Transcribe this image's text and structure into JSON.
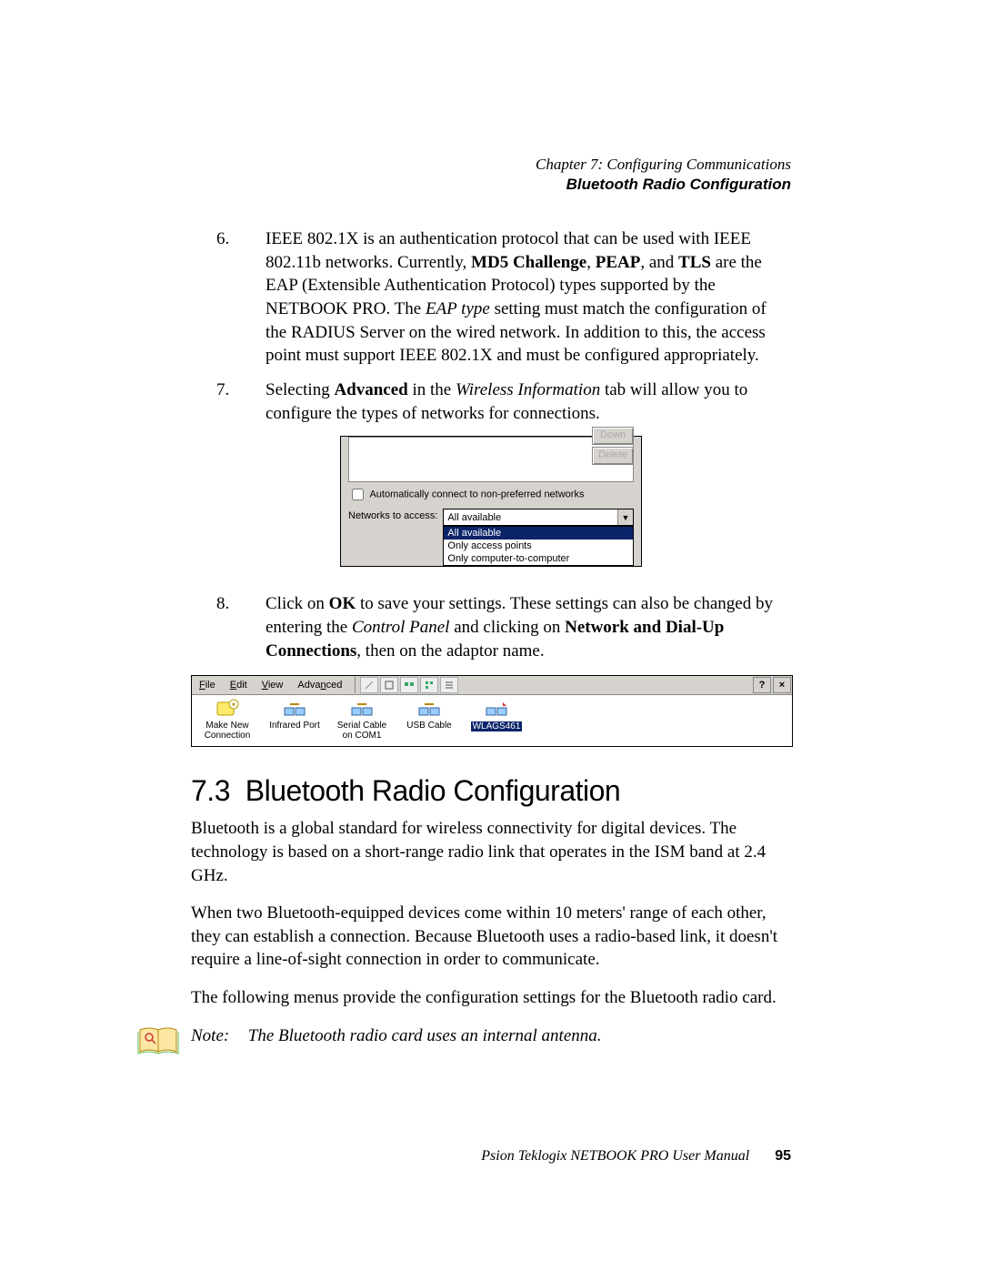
{
  "header": {
    "chapter": "Chapter 7:  Configuring Communications",
    "subtitle": "Bluetooth Radio Configuration"
  },
  "steps": {
    "s6": {
      "num": "6.",
      "text_pre": "IEEE 802.1X is an authentication protocol that can be used with IEEE 802.11b networks. Currently, ",
      "md5": "MD5 Challenge",
      "sep1": ", ",
      "peap": "PEAP",
      "sep2": ", and ",
      "tls": "TLS",
      "text_post1": " are the EAP (Extensible Authentication Protocol) types supported by the NETBOOK PRO. The ",
      "eaptype": "EAP type",
      "text_post2": " setting must match the configuration of the RADIUS Server on the wired network. In addition to this, the access point must support IEEE 802.1X and must be configured appropriately."
    },
    "s7": {
      "num": "7.",
      "t1": "Selecting ",
      "adv": "Advanced",
      "t2": " in the ",
      "wi": "Wireless Information",
      "t3": " tab will allow you to configure the types of networks for connections."
    },
    "s8": {
      "num": "8.",
      "t1": "Click on ",
      "ok": "OK",
      "t2": " to save your settings. These settings can also be changed by entering the ",
      "cp": "Control Panel",
      "t3": " and clicking on ",
      "ndc": "Network and Dial-Up Connections",
      "t4": ", then on the adaptor name."
    }
  },
  "shot1": {
    "down_btn": "Down",
    "delete_btn": "Delete",
    "checkbox_label": "Automatically connect to non-preferred networks",
    "networks_label": "Networks to access:",
    "selected": "All available",
    "options": [
      "All available",
      "Only access points",
      "Only computer-to-computer"
    ]
  },
  "shot2": {
    "menus": {
      "file": "File",
      "edit": "Edit",
      "view": "View",
      "advanced": "Advanced"
    },
    "help_btn": "?",
    "close_btn": "×",
    "icons": [
      {
        "label_line1": "Make New",
        "label_line2": "Connection"
      },
      {
        "label_line1": "Infrared Port",
        "label_line2": ""
      },
      {
        "label_line1": "Serial Cable",
        "label_line2": "on COM1"
      },
      {
        "label_line1": "USB Cable",
        "label_line2": ""
      },
      {
        "label_line1": "WLAGS461",
        "label_line2": ""
      }
    ]
  },
  "section": {
    "number": "7.3",
    "title": "Bluetooth Radio Configuration"
  },
  "body": {
    "p1": "Bluetooth is a global standard for wireless connectivity for digital devices. The technology is based on a short-range radio link that operates in the ISM band at 2.4 GHz.",
    "p2": "When two Bluetooth-equipped devices come within 10 meters' range of each other, they can establish a connection. Because Bluetooth uses a radio-based link, it doesn't require a line-of-sight connection in order to communicate.",
    "p3": "The following menus provide the configuration settings for the Bluetooth radio card."
  },
  "note": {
    "label": "Note:",
    "text": "The Bluetooth radio card uses an internal antenna."
  },
  "footer": {
    "manual": "Psion Teklogix NETBOOK PRO User Manual",
    "page": "95"
  }
}
